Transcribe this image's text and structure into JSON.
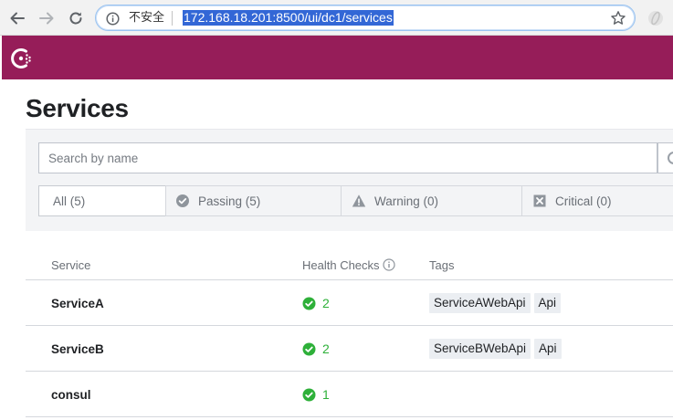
{
  "browser": {
    "security_label": "不安全",
    "url": "172.168.18.201:8500/ui/dc1/services"
  },
  "page": {
    "title": "Services"
  },
  "search": {
    "placeholder": "Search by name"
  },
  "filters": {
    "all": "All (5)",
    "passing": "Passing (5)",
    "warning": "Warning (0)",
    "critical": "Critical (0)"
  },
  "table": {
    "headers": {
      "service": "Service",
      "health": "Health Checks",
      "tags": "Tags"
    },
    "rows": [
      {
        "name": "ServiceA",
        "checks": "2",
        "tags": [
          "ServiceAWebApi",
          "Api"
        ]
      },
      {
        "name": "ServiceB",
        "checks": "2",
        "tags": [
          "ServiceBWebApi",
          "Api"
        ]
      },
      {
        "name": "consul",
        "checks": "1",
        "tags": []
      }
    ]
  },
  "colors": {
    "brand": "#961d59",
    "passing": "#2eb039",
    "url_highlight": "#3367d6"
  }
}
